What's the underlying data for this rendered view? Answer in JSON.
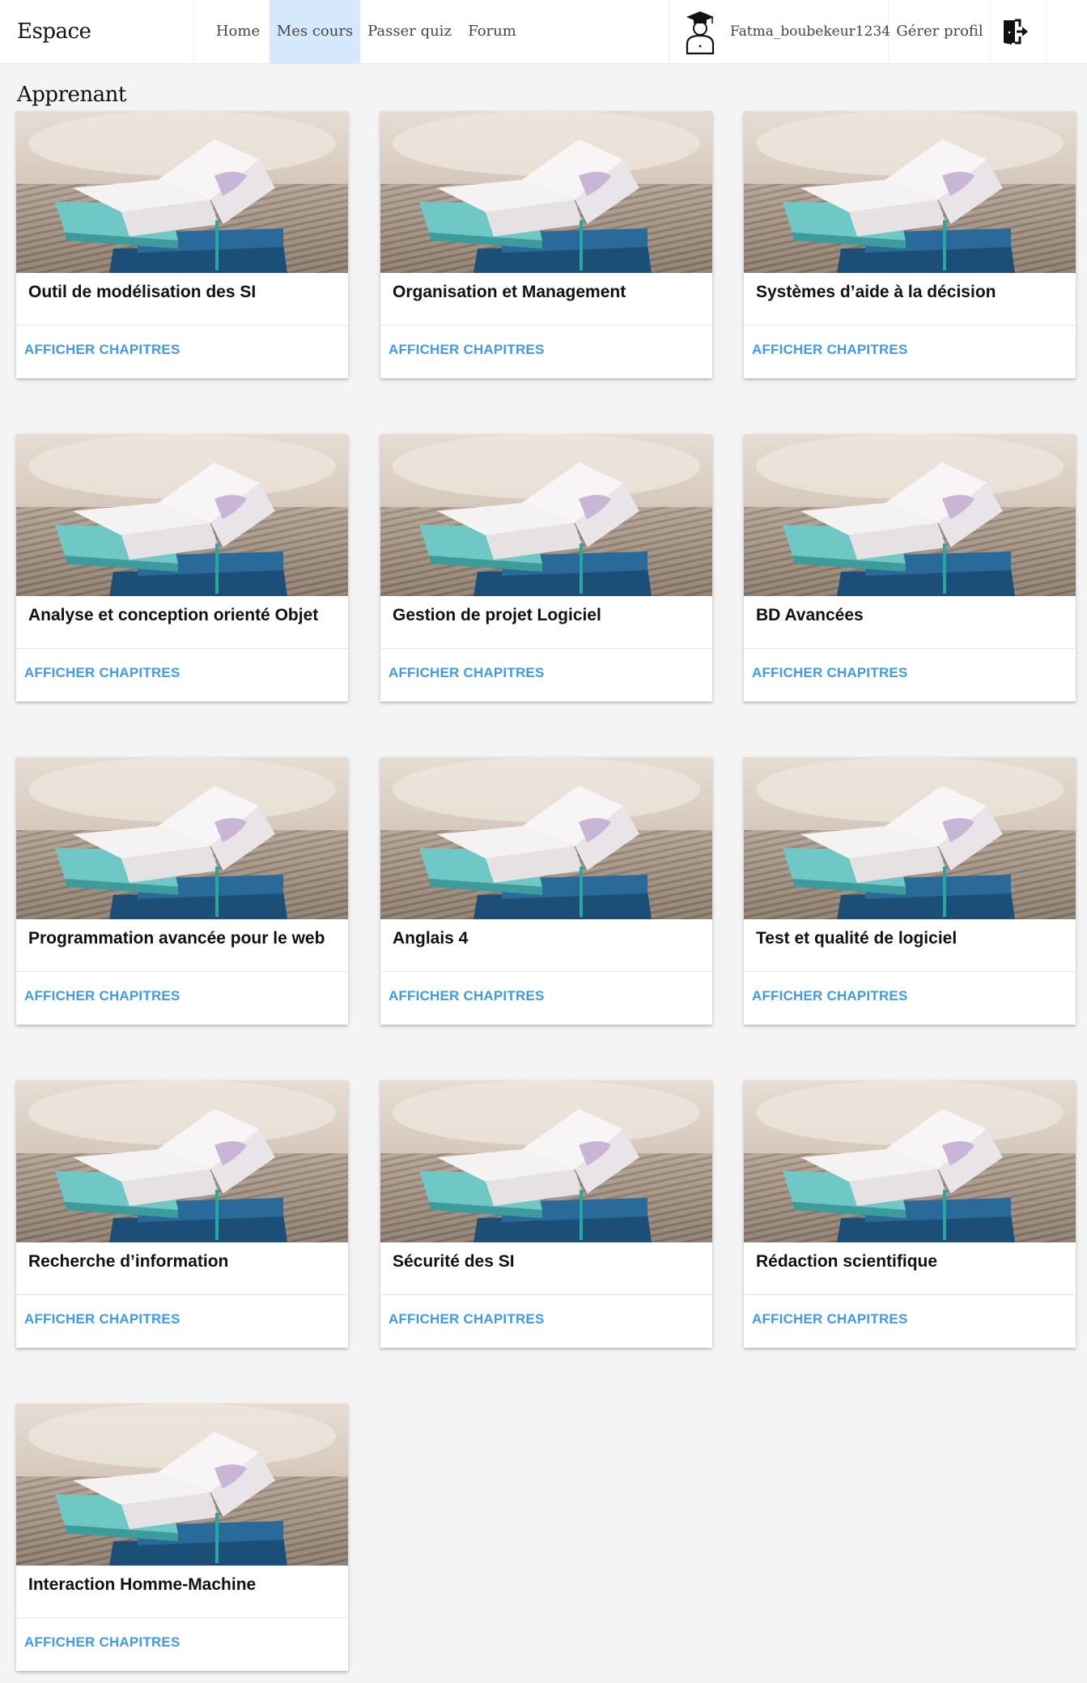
{
  "header": {
    "brand": "Espace Apprenant",
    "nav": [
      {
        "label": "Home"
      },
      {
        "label": "Mes cours"
      },
      {
        "label": "Passer quiz"
      },
      {
        "label": "Forum"
      }
    ],
    "username": "Fatma_boubekeur1234",
    "manage_profile": "Gérer profil",
    "active_nav": "Mes cours"
  },
  "courses": [
    {
      "title": "Outil de modélisation des SI",
      "action": "AFFICHER CHAPITRES"
    },
    {
      "title": "Organisation et Management",
      "action": "AFFICHER CHAPITRES"
    },
    {
      "title": "Systèmes d’aide à la décision",
      "action": "AFFICHER CHAPITRES"
    },
    {
      "title": "Analyse et conception orienté Objet",
      "action": "AFFICHER CHAPITRES"
    },
    {
      "title": "Gestion de projet Logiciel",
      "action": "AFFICHER CHAPITRES"
    },
    {
      "title": "BD Avancées",
      "action": "AFFICHER CHAPITRES"
    },
    {
      "title": "Programmation avancée pour le web",
      "action": "AFFICHER CHAPITRES"
    },
    {
      "title": "Anglais 4",
      "action": "AFFICHER CHAPITRES"
    },
    {
      "title": "Test et qualité de logiciel",
      "action": "AFFICHER CHAPITRES"
    },
    {
      "title": "Recherche d’information",
      "action": "AFFICHER CHAPITRES"
    },
    {
      "title": "Sécurité des SI",
      "action": "AFFICHER CHAPITRES"
    },
    {
      "title": "Rédaction scientifique",
      "action": "AFFICHER CHAPITRES"
    },
    {
      "title": "Interaction Homme-Machine",
      "action": "AFFICHER CHAPITRES"
    }
  ],
  "colors": {
    "accent": "#3f9ae8",
    "active_nav_bg": "#d6e9fc",
    "page_bg": "#f4f4f4"
  },
  "icons": {
    "avatar": "graduate-student-icon",
    "logout": "logout-icon",
    "course_image": "open-books-image"
  }
}
